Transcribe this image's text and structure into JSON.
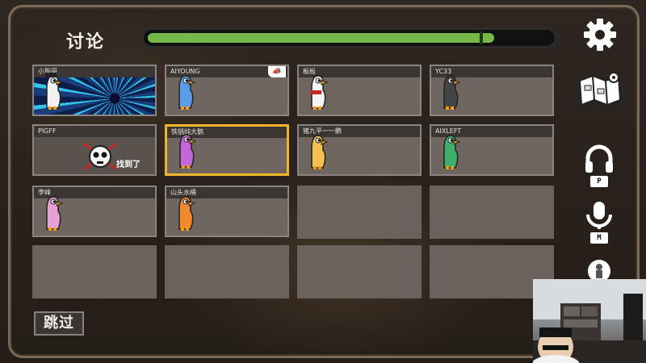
{
  "header": {
    "title": "讨论",
    "timer_progress": 0.86
  },
  "players": [
    {
      "name": "小狗哥",
      "color": "#f2f2f2",
      "scene": true,
      "hat": true
    },
    {
      "name": "AIYOUNG",
      "color": "#5b9ee8",
      "speaker": true
    },
    {
      "name": "板板",
      "color": "#f5f5f5",
      "scarf": true
    },
    {
      "name": "YC33",
      "color": "#444444"
    },
    {
      "name": "PIGFF",
      "dead": true,
      "found_label": "找到了"
    },
    {
      "name": "铁锅炖大鹅",
      "color": "#c465d8",
      "selected": true
    },
    {
      "name": "猪九平一一鹏",
      "color": "#f3c04f"
    },
    {
      "name": "AIXLEFT",
      "color": "#3fae6a"
    },
    {
      "name": "李峰",
      "color": "#e7a1d6"
    },
    {
      "name": "山头水桶",
      "color": "#f08a2d"
    }
  ],
  "skip_button": {
    "label": "跳过"
  },
  "sidebar": {
    "settings_icon": "gear-icon",
    "map_icon": "map-icon",
    "headphones_key": "P",
    "mic_key": "M",
    "profile_icon": "pawn-icon"
  },
  "megaphone_icon": "📣"
}
